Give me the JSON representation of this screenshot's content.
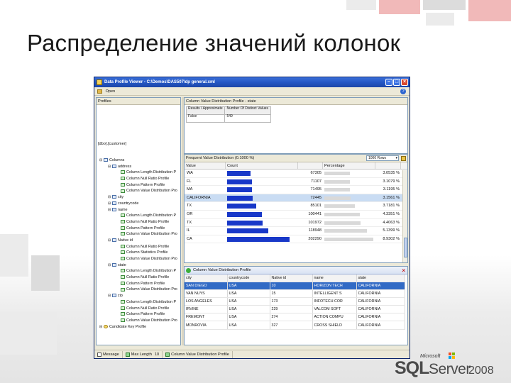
{
  "slide": {
    "title": "Распределение значений колонок"
  },
  "window": {
    "title": "Data Profile Viewer - C:\\Demos\\DAS507\\dp general.xml",
    "menu_open": "Open",
    "profiles_label": "Profiles",
    "db_node": "[dbo].[customer]",
    "tree": [
      {
        "label": "Columns",
        "depth": 0,
        "icon": "folder"
      },
      {
        "label": "address",
        "depth": 1,
        "icon": "table"
      },
      {
        "label": "Column Length Distribution P",
        "depth": 2,
        "icon": "check"
      },
      {
        "label": "Column Null Ratio Profile",
        "depth": 2,
        "icon": "check"
      },
      {
        "label": "Column Pattern Profile",
        "depth": 2,
        "icon": "check"
      },
      {
        "label": "Column Value Distribution Pro",
        "depth": 2,
        "icon": "check"
      },
      {
        "label": "city",
        "depth": 1,
        "icon": "table"
      },
      {
        "label": "countrycode",
        "depth": 1,
        "icon": "table"
      },
      {
        "label": "name",
        "depth": 1,
        "icon": "table"
      },
      {
        "label": "Column Length Distribution P",
        "depth": 2,
        "icon": "check"
      },
      {
        "label": "Column Null Ratio Profile",
        "depth": 2,
        "icon": "check"
      },
      {
        "label": "Column Pattern Profile",
        "depth": 2,
        "icon": "check"
      },
      {
        "label": "Column Value Distribution Pro",
        "depth": 2,
        "icon": "check"
      },
      {
        "label": "Native id",
        "depth": 1,
        "icon": "table"
      },
      {
        "label": "Column Null Ratio Profile",
        "depth": 2,
        "icon": "check"
      },
      {
        "label": "Column Statistics Profile",
        "depth": 2,
        "icon": "check"
      },
      {
        "label": "Column Value Distribution Pro",
        "depth": 2,
        "icon": "check"
      },
      {
        "label": "state",
        "depth": 1,
        "icon": "table"
      },
      {
        "label": "Column Length Distribution P",
        "depth": 2,
        "icon": "check"
      },
      {
        "label": "Column Null Ratio Profile",
        "depth": 2,
        "icon": "check"
      },
      {
        "label": "Column Pattern Profile",
        "depth": 2,
        "icon": "check"
      },
      {
        "label": "Column Value Distribution Pro",
        "depth": 2,
        "icon": "check"
      },
      {
        "label": "zip",
        "depth": 1,
        "icon": "table"
      },
      {
        "label": "Column Length Distribution P",
        "depth": 2,
        "icon": "check"
      },
      {
        "label": "Column Null Ratio Profile",
        "depth": 2,
        "icon": "check"
      },
      {
        "label": "Column Pattern Profile",
        "depth": 2,
        "icon": "check"
      },
      {
        "label": "Column Value Distribution Pro",
        "depth": 2,
        "icon": "check"
      },
      {
        "label": "Candidate Key Profile",
        "depth": 0,
        "icon": "key"
      }
    ],
    "breadcrumb": "Column Value Distribution Profile  -  state",
    "summary": {
      "h1": "Results / Approximate",
      "h2": "Number Of Distinct Values",
      "v1": "False",
      "v2": "549"
    },
    "freq_header": "Frequent Value Distribution (0.1000 %)",
    "rows_select": "1000 Rows",
    "freq_columns": [
      "Value",
      "Count",
      "",
      "Percentage",
      ""
    ],
    "freq_rows": [
      {
        "value": "WA",
        "count": "67305",
        "bar": 0.34,
        "pct": "3.0535 %",
        "pctv": 0.51
      },
      {
        "value": "FL",
        "count": "71107",
        "bar": 0.36,
        "pct": "3.1079 %",
        "pctv": 0.52
      },
      {
        "value": "MA",
        "count": "71495",
        "bar": 0.36,
        "pct": "3.1195 %",
        "pctv": 0.52
      },
      {
        "value": "CALIFORNIA",
        "count": "72445",
        "bar": 0.37,
        "pct": "3.1561 %",
        "pctv": 0.53
      },
      {
        "value": "TX",
        "count": "85101",
        "bar": 0.43,
        "pct": "3.7181 %",
        "pctv": 0.62
      },
      {
        "value": "OR",
        "count": "100441",
        "bar": 0.51,
        "pct": "4.3351 %",
        "pctv": 0.72
      },
      {
        "value": "TX",
        "count": "101972",
        "bar": 0.52,
        "pct": "4.4063 %",
        "pctv": 0.73
      },
      {
        "value": "IL",
        "count": "118948",
        "bar": 0.6,
        "pct": "5.1399 %",
        "pctv": 0.85
      },
      {
        "value": "CA",
        "count": "202290",
        "bar": 0.92,
        "pct": "8.9302 %",
        "pctv": 0.98
      }
    ],
    "drill_header": "Column Value Distribution Profile",
    "drill_columns": [
      "city",
      "countrycode",
      "Native id",
      "name",
      "state"
    ],
    "drill_rows": [
      [
        "SAN DIEGO",
        "USA",
        "10",
        "HORIZON TECH",
        "CALIFORNIA"
      ],
      [
        "VAN NUYS",
        "USA",
        "15",
        "INTELLIGENT S",
        "CALIFORNIA"
      ],
      [
        "LOS ANGELES",
        "USA",
        "173",
        "INFOTECH COR",
        "CALIFORNIA"
      ],
      [
        "IRVINE",
        "USA",
        "229",
        "VALCOM SOFT",
        "CALIFORNIA"
      ],
      [
        "FREMONT",
        "USA",
        "274",
        "ACTION COMPU",
        "CALIFORNIA"
      ],
      [
        "MONROVIA",
        "USA",
        "327",
        "CROSS SHIELD",
        "CALIFORNIA"
      ]
    ],
    "status": {
      "message": "Message",
      "length": "Max Length",
      "length_val": "10",
      "profile": "Column Value Distribution Profile"
    }
  },
  "logo": {
    "microsoft": "Microsoft",
    "sql": "SQL",
    "server": "Server",
    "year": "2008"
  },
  "colors": {
    "bar": "#1838c8",
    "selection": "#316ac5",
    "titlebar": "#2457c5",
    "accent_red": "#f1b9b9"
  }
}
